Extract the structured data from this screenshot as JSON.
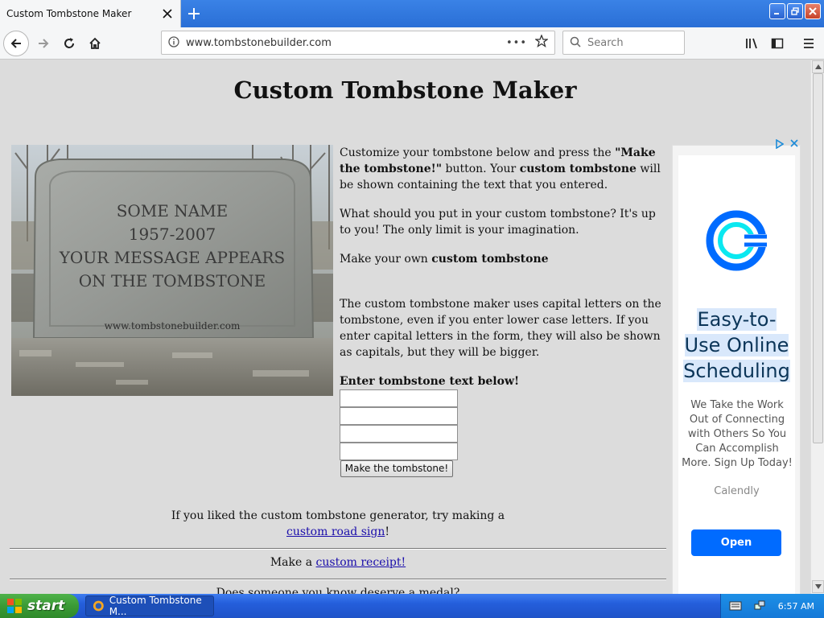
{
  "browser": {
    "tab_title": "Custom Tombstone Maker",
    "url": "www.tombstonebuilder.com",
    "search_placeholder": "Search",
    "url_dots": "•••"
  },
  "page": {
    "title": "Custom Tombstone Maker",
    "tombstone_lines": [
      "SOME NAME",
      "1957-2007",
      "YOUR MESSAGE APPEARS",
      "ON THE TOMBSTONE"
    ],
    "tombstone_site": "www.tombstonebuilder.com",
    "intro": {
      "p1_a": "Customize your tombstone below and press the ",
      "p1_b": "\"Make the tombstone!\"",
      "p1_c": " button. Your ",
      "p1_d": "custom tombstone",
      "p1_e": " will be shown containing the text that you entered.",
      "p2": "What should you put in your custom tombstone? It's up to you! The only limit is your imagination.",
      "p3_a": "Make your own ",
      "p3_b": "custom tombstone",
      "p4": "The custom tombstone maker uses capital letters on the tombstone, even if you enter lower case letters. If you enter capital letters in the form, they will also be shown as capitals, but they will be bigger."
    },
    "form_label": "Enter tombstone text below!",
    "fields": [
      "",
      "",
      "",
      ""
    ],
    "submit_label": "Make the tombstone!",
    "promo1_a": "If you liked the custom tombstone generator, try making a",
    "promo1_link": "custom road sign",
    "promo1_end": "!",
    "promo2_a": "Make a ",
    "promo2_link": "custom receipt!",
    "promo3": "Does someone you know deserve a medal?"
  },
  "ad": {
    "headline_lines": [
      "Easy-to-",
      "Use Online",
      "Scheduling"
    ],
    "body": "We Take the Work Out of Connecting with Others So You Can Accomplish More. Sign Up Today!",
    "brand": "Calendly",
    "cta": "Open",
    "brand_color": "#006bff"
  },
  "taskbar": {
    "start_label": "start",
    "task_label": "Custom Tombstone M...",
    "clock": "6:57 AM"
  }
}
